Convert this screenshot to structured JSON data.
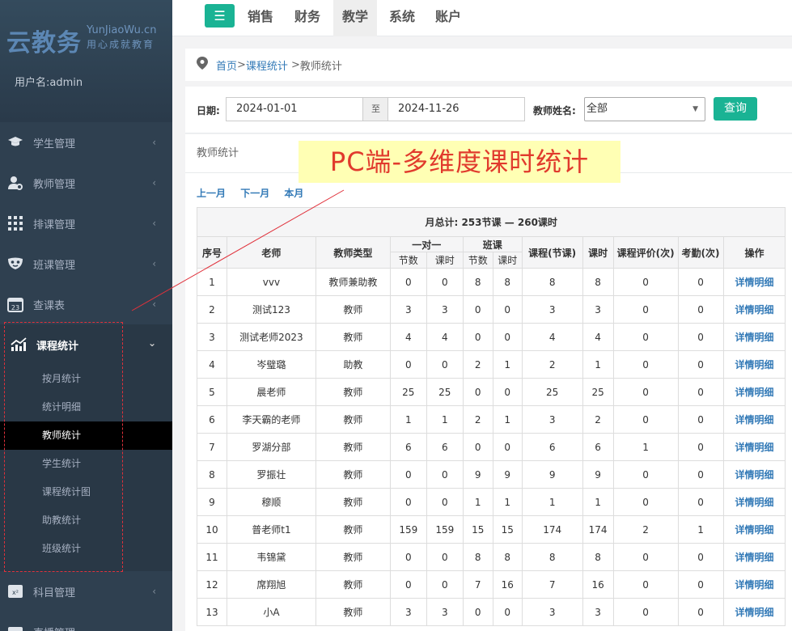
{
  "sidebar": {
    "logo": {
      "cn": "云教务",
      "en": "YunJiaoWu.cn",
      "sub": "用心成就教育"
    },
    "username": "用户名:admin",
    "items": [
      {
        "label": "学生管理",
        "icon": "graduation-cap-icon"
      },
      {
        "label": "教师管理",
        "icon": "teacher-icon"
      },
      {
        "label": "排课管理",
        "icon": "grid-icon"
      },
      {
        "label": "班课管理",
        "icon": "mask-icon"
      },
      {
        "label": "查课表",
        "icon": "calendar-icon"
      },
      {
        "label": "课程统计",
        "icon": "chart-icon"
      },
      {
        "label": "科目管理",
        "icon": "formula-icon"
      },
      {
        "label": "直播管理",
        "icon": "live-icon"
      }
    ],
    "submenu": [
      "按月统计",
      "统计明细",
      "教师统计",
      "学生统计",
      "课程统计图",
      "助教统计",
      "班级统计"
    ],
    "active_sub": "教师统计"
  },
  "topnav": {
    "tabs": [
      "销售",
      "财务",
      "教学",
      "系统",
      "账户"
    ],
    "active": "教学"
  },
  "breadcrumb": {
    "home": "首页",
    "sep1": ">",
    "stats": "课程统计",
    "sep2": ">",
    "current": "教师统计"
  },
  "filter": {
    "date_label": "日期:",
    "start": "2024-01-01",
    "to": "至",
    "end": "2024-11-26",
    "teacher_label": "教师姓名:",
    "teacher_value": "全部",
    "query": "查询"
  },
  "content": {
    "section_title": "教师统计",
    "nav": {
      "prev": "上一月",
      "next": "下一月",
      "this": "本月"
    }
  },
  "table": {
    "summary": "月总计: 253节课 — 260课时",
    "headers": {
      "no": "序号",
      "teacher": "老师",
      "type": "教师类型",
      "one_on_one": "一对一",
      "class": "班课",
      "lessons": "节数",
      "hours": "课时",
      "course_lessons": "课程(节课)",
      "course_hours": "课时",
      "rating": "课程评价(次)",
      "attendance": "考勤(次)",
      "op": "操作"
    },
    "rows": [
      [
        "1",
        "vvv",
        "教师兼助教",
        "0",
        "0",
        "8",
        "8",
        "8",
        "8",
        "0",
        "0",
        "详情明细"
      ],
      [
        "2",
        "测试123",
        "教师",
        "3",
        "3",
        "0",
        "0",
        "3",
        "3",
        "0",
        "0",
        "详情明细"
      ],
      [
        "3",
        "测试老师2023",
        "教师",
        "4",
        "4",
        "0",
        "0",
        "4",
        "4",
        "0",
        "0",
        "详情明细"
      ],
      [
        "4",
        "岑璧璐",
        "助教",
        "0",
        "0",
        "2",
        "1",
        "2",
        "1",
        "0",
        "0",
        "详情明细"
      ],
      [
        "5",
        "晨老师",
        "教师",
        "25",
        "25",
        "0",
        "0",
        "25",
        "25",
        "0",
        "0",
        "详情明细"
      ],
      [
        "6",
        "李天霸的老师",
        "教师",
        "1",
        "1",
        "2",
        "1",
        "3",
        "2",
        "0",
        "0",
        "详情明细"
      ],
      [
        "7",
        "罗湖分部",
        "教师",
        "6",
        "6",
        "0",
        "0",
        "6",
        "6",
        "1",
        "0",
        "详情明细"
      ],
      [
        "8",
        "罗振壮",
        "教师",
        "0",
        "0",
        "9",
        "9",
        "9",
        "9",
        "0",
        "0",
        "详情明细"
      ],
      [
        "9",
        "穆顺",
        "教师",
        "0",
        "0",
        "1",
        "1",
        "1",
        "1",
        "0",
        "0",
        "详情明细"
      ],
      [
        "10",
        "普老师t1",
        "教师",
        "159",
        "159",
        "15",
        "15",
        "174",
        "174",
        "2",
        "1",
        "详情明细"
      ],
      [
        "11",
        "韦锦黛",
        "教师",
        "0",
        "0",
        "8",
        "8",
        "8",
        "8",
        "0",
        "0",
        "详情明细"
      ],
      [
        "12",
        "席翔旭",
        "教师",
        "0",
        "0",
        "7",
        "16",
        "7",
        "16",
        "0",
        "0",
        "详情明细"
      ],
      [
        "13",
        "小A",
        "教师",
        "3",
        "3",
        "0",
        "0",
        "3",
        "3",
        "0",
        "0",
        "详情明细"
      ]
    ]
  },
  "annotation": "PC端-多维度课时统计"
}
